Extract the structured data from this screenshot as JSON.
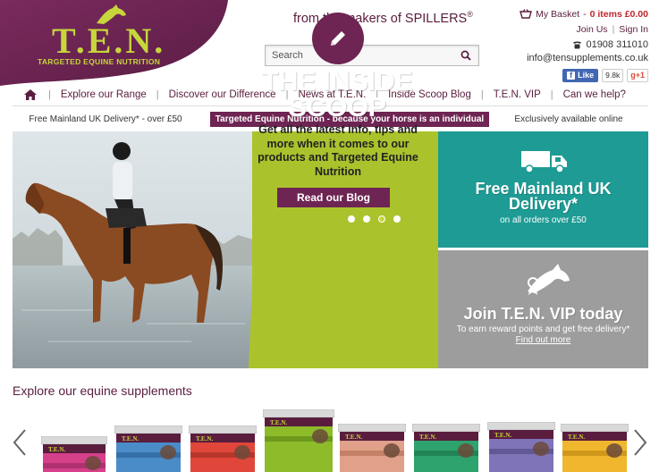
{
  "brand": {
    "logo_text": "T.E.N.",
    "logo_sub": "TARGETED EQUINE NUTRITION",
    "makers": "from the makers of SPILLERS",
    "makers_mark": "®",
    "colors": {
      "purple": "#6e2553",
      "lime": "#c6d63b",
      "green": "#aac32c",
      "teal": "#1d9b94",
      "grey": "#9d9d9d"
    }
  },
  "search": {
    "placeholder": "Search"
  },
  "account": {
    "basket_label": "My Basket",
    "basket_sep": "-",
    "basket_items": "0 items £0.00",
    "join": "Join Us",
    "join_sep": "|",
    "signin": "Sign In",
    "phone": "01908 311010",
    "email": "info@tensupplements.co.uk",
    "fb_like": "Like",
    "fb_count": "9.8k",
    "gplus": "+1"
  },
  "nav": {
    "items": [
      "Explore our Range",
      "Discover our Difference",
      "News at T.E.N.",
      "Inside Scoop Blog",
      "T.E.N. VIP",
      "Can we help?"
    ],
    "sep": "|"
  },
  "strip": {
    "left": "Free Mainland UK Delivery* - over £50",
    "mid": "Targeted Equine Nutrition - because your horse is an individual",
    "right": "Exclusively available online"
  },
  "hero": {
    "title_line1": "THE INSIDE",
    "title_line2": "SCOOP",
    "desc": "Get all the latest info, tips and more when it comes to our products and Targeted Equine Nutrition",
    "button": "Read our Blog"
  },
  "tiles": {
    "delivery_title_1": "Free Mainland UK",
    "delivery_title_2": "Delivery*",
    "delivery_sub": "on all orders over £50",
    "vip_title": "Join T.E.N. VIP today",
    "vip_sub": "To earn reward points and get free delivery*",
    "vip_link": "Find out more"
  },
  "products": {
    "heading": "Explore our equine supplements",
    "tubs": [
      {
        "label": "T.E.N.",
        "lid": "#d9d9d9",
        "body": "#d6408a",
        "band": "#b03170"
      },
      {
        "label": "T.E.N.",
        "lid": "#d9d9d9",
        "body": "#4a8cc8",
        "band": "#3570a8"
      },
      {
        "label": "T.E.N.",
        "lid": "#d9d9d9",
        "body": "#e0473a",
        "band": "#b8352b"
      },
      {
        "label": "T.E.N.",
        "lid": "#d9d9d9",
        "body": "#8dbb2a",
        "band": "#6d9a1c"
      },
      {
        "label": "T.E.N.",
        "lid": "#d9d9d9",
        "body": "#e0a08a",
        "band": "#c58068"
      },
      {
        "label": "T.E.N.",
        "lid": "#d9d9d9",
        "body": "#2ea36d",
        "band": "#208456"
      },
      {
        "label": "T.E.N.",
        "lid": "#d9d9d9",
        "body": "#7f74b8",
        "band": "#625898"
      },
      {
        "label": "T.E.N.",
        "lid": "#d9d9d9",
        "body": "#f0b72e",
        "band": "#d0981a"
      }
    ]
  }
}
